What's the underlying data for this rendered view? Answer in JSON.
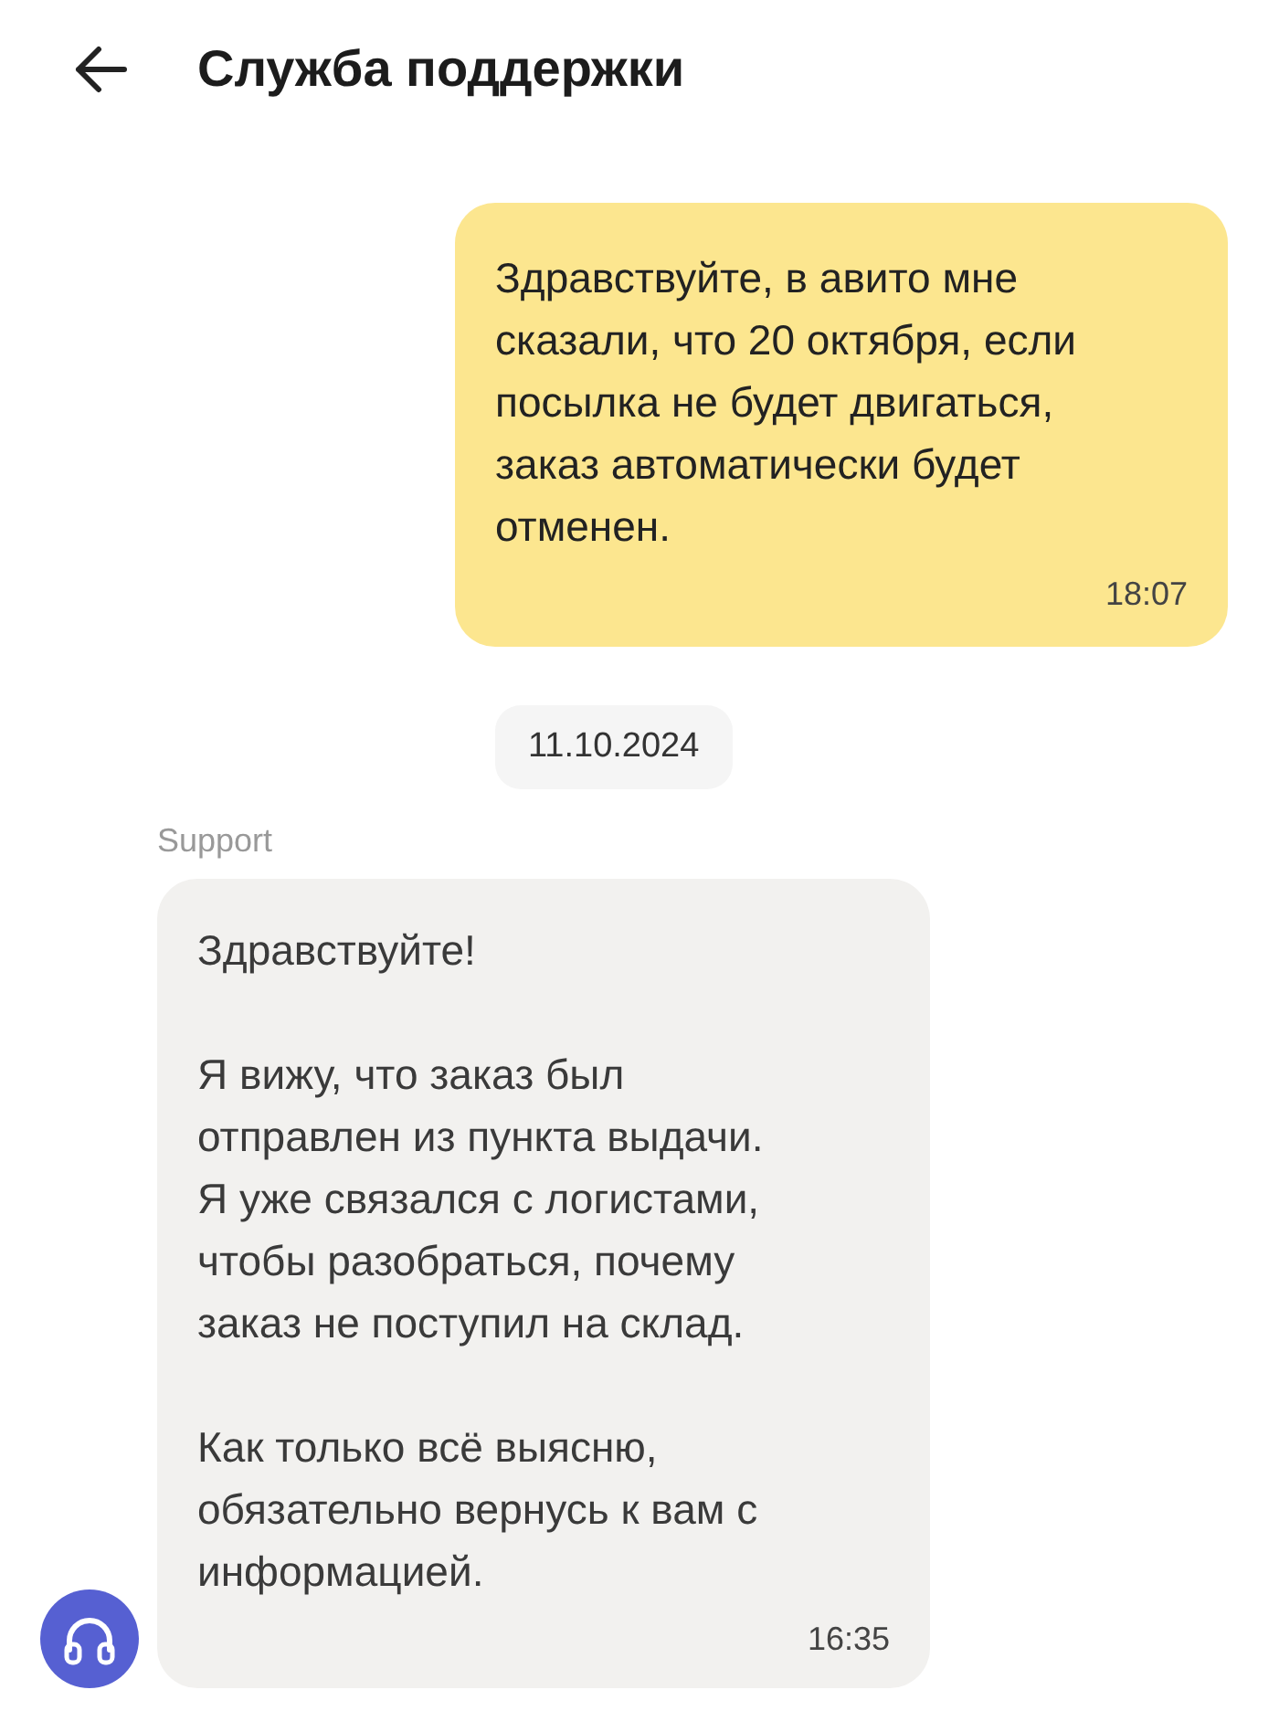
{
  "header": {
    "title": "Служба поддержки"
  },
  "messages": [
    {
      "kind": "outgoing",
      "paragraphs": [
        "Здравствуйте, в авито мне\nсказали, что 20 октября, если\nпосылка не будет двигаться,\nзаказ автоматически будет\nотменен."
      ],
      "time": "18:07"
    },
    {
      "kind": "date",
      "text": "11.10.2024"
    },
    {
      "kind": "incoming",
      "sender": "Support",
      "paragraphs": [
        "Здравствуйте!",
        "Я вижу, что заказ был\nотправлен из пункта выдачи.\nЯ уже связался с логистами,\nчтобы разобраться, почему\nзаказ не поступил на склад.",
        "Как только всё выясню,\nобязательно вернусь к вам с\nинформацией."
      ],
      "time": "16:35"
    }
  ]
}
